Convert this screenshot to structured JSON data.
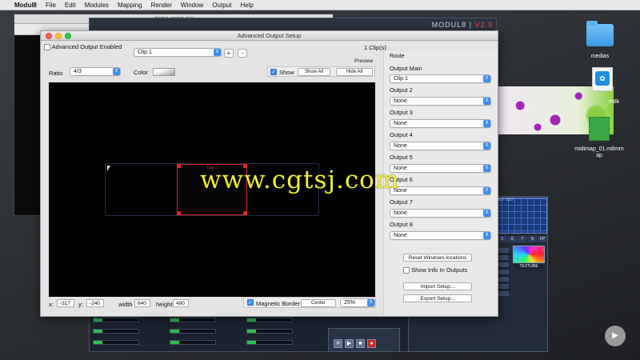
{
  "menubar": {
    "app": "Modul8",
    "items": [
      "File",
      "Edit",
      "Modules",
      "Mapping",
      "Render",
      "Window",
      "Output",
      "Help"
    ]
  },
  "background": {
    "left_window_title": "demo_prpjp.jpg",
    "modul8_logo": "MODUL8",
    "modul8_version": "V2.9",
    "out_labels": "OUT    OUT",
    "num_row": [
      "5",
      "6",
      "7",
      "8",
      "FP"
    ],
    "texture_label": "TEXTURE",
    "transport_buttons": [
      "✕",
      "▶",
      "■",
      "●"
    ]
  },
  "desktop": {
    "icons": [
      {
        "label": "medias",
        "icon": "folder-icon"
      },
      {
        "label": "m8k",
        "icon": "document-icon"
      },
      {
        "label": "midimap_01.m8mmap",
        "icon": "document-icon"
      }
    ]
  },
  "dialog": {
    "title": "Advanced Output Setup",
    "enabled_label": "Advanced Output Enabled",
    "clip_select": "Clip 1",
    "clip_count": "1 Clip(s)",
    "plus": "+",
    "minus": "-",
    "preview_label": "Preview",
    "ratio_label": "Ratio",
    "ratio_value": "4/3",
    "color_label": "Color",
    "show_label": "Show",
    "show_all": "Show All",
    "hide_all": "Hide All",
    "clip_overlay_label": "Clip 1",
    "x_label": "x:",
    "x_value": "-317",
    "y_label": "y:",
    "y_value": "-240",
    "width_label": "width",
    "width_value": "640",
    "height_label": "height",
    "height_value": "480",
    "magnetic_label": "Magnetic Border",
    "align_select": "Center",
    "zoom_select": "25%",
    "watermark": "www.cgtsj.com",
    "route": {
      "heading": "Route",
      "outputs": [
        {
          "label": "Output Main",
          "value": "Clip 1"
        },
        {
          "label": "Output 2",
          "value": "None"
        },
        {
          "label": "Output 3",
          "value": "None"
        },
        {
          "label": "Output 4",
          "value": "None"
        },
        {
          "label": "Output 5",
          "value": "None"
        },
        {
          "label": "Output 6",
          "value": "None"
        },
        {
          "label": "Output 7",
          "value": "None"
        },
        {
          "label": "Output 8",
          "value": "None"
        }
      ],
      "reset_button": "Reset Windows locations",
      "show_info_label": "Show Info In Outputs",
      "import_button": "Import Setup...",
      "export_button": "Export Setup..."
    }
  }
}
